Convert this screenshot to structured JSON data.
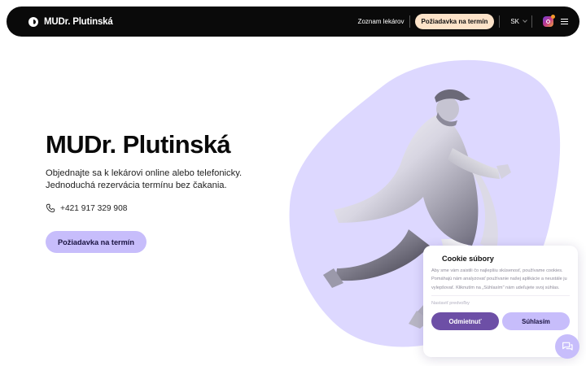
{
  "header": {
    "brand": "MUDr. Plutinská",
    "nav_link": "Zoznam lekárov",
    "cta": "Požiadavka na termín",
    "language": "SK"
  },
  "hero": {
    "title": "MUDr. Plutinská",
    "description": "Objednajte sa k lekárovi online alebo telefonicky. Jednoduchá rezervácia termínu bez čakania.",
    "phone": "+421 917 329 908",
    "cta": "Požiadavka na termín"
  },
  "cookie": {
    "title": "Cookie súbory",
    "text": "Aby sme vám zaistili čo najlepšiu skúsenosť, používame cookies. Pomáhajú nám analyzovať používanie našej aplikácie a neustále ju vylepšovať. Kliknutím na „Súhlasím\" nám udeľujete svoj súhlas.",
    "settings": "Nastaviť predvoľby",
    "decline": "Odmietnuť",
    "accept": "Súhlasím"
  },
  "icons": {
    "logo": "logo-icon",
    "language_dropdown": "chevron-down-icon",
    "instagram": "instagram-icon",
    "menu": "hamburger-menu-icon",
    "phone": "phone-icon",
    "chat": "chat-icon"
  },
  "colors": {
    "header_bg": "#0a0a0a",
    "nav_cta_bg": "#fde3c9",
    "accent_lavender": "#c7bdfb",
    "blob": "#ddd8ff",
    "decline_btn": "#6d4fa6"
  }
}
